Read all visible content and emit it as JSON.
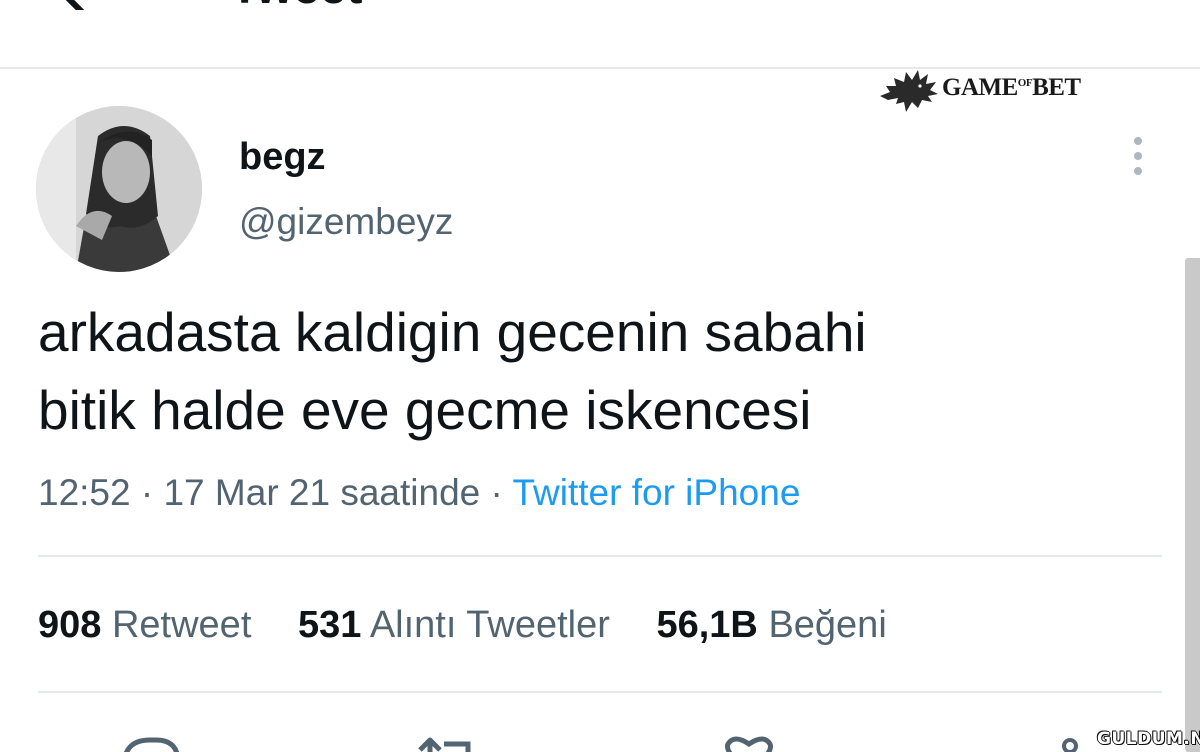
{
  "header": {
    "title": "Tweet"
  },
  "watermark": {
    "brand_game": "GAME",
    "brand_of": "OF",
    "brand_bet": "BET",
    "site": "GULDUM.NET"
  },
  "tweet": {
    "display_name": "begz",
    "handle": "@gizembeyz",
    "text_line1": "arkadasta kaldigin gecenin sabahi",
    "text_line2": "bitik halde eve gecme iskencesi",
    "time": "12:52",
    "date": "17 Mar 21 saatinde",
    "separator": "·",
    "source": "Twitter for iPhone"
  },
  "stats": [
    {
      "count": "908",
      "label": "Retweet"
    },
    {
      "count": "531",
      "label": "Alıntı Tweetler"
    },
    {
      "count": "56,1B",
      "label": "Beğeni"
    }
  ],
  "icons": {
    "back": "arrow-left-icon",
    "more": "more-vertical-icon",
    "reply": "reply-icon",
    "retweet": "retweet-icon",
    "like": "heart-icon",
    "share": "share-icon",
    "brand": "wolf-icon"
  },
  "colors": {
    "text_primary": "#0f1419",
    "text_secondary": "#536471",
    "link": "#1d9bf0",
    "divider": "#e6e9ec"
  }
}
